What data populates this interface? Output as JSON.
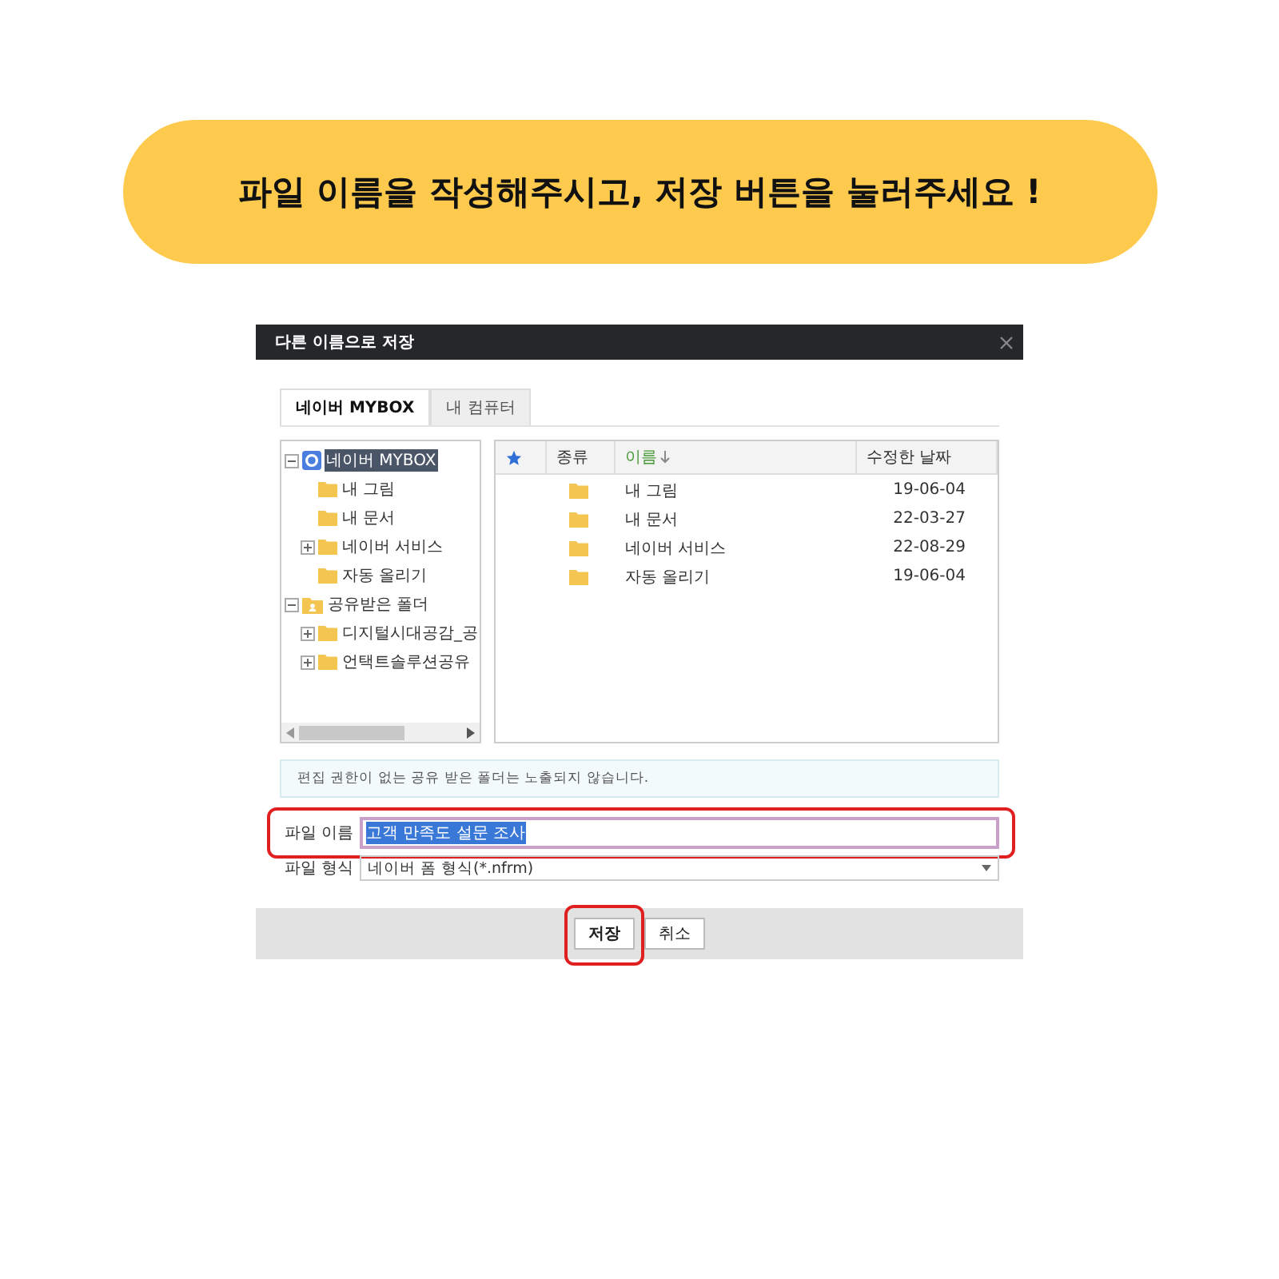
{
  "banner": {
    "text": "파일 이름을 작성해주시고, 저장 버튼을 눌러주세요 !"
  },
  "dialog": {
    "title": "다른 이름으로 저장",
    "tabs": [
      {
        "label": "네이버 MYBOX",
        "selected": true
      },
      {
        "label": "내 컴퓨터",
        "selected": false
      }
    ],
    "tree": [
      {
        "label": "네이버 MYBOX",
        "kind": "cloud",
        "expanded": true,
        "selected": true,
        "children": [
          {
            "label": "내 그림",
            "kind": "folder",
            "selected": false
          },
          {
            "label": "내 문서",
            "kind": "folder",
            "selected": false
          },
          {
            "label": "네이버 서비스",
            "kind": "folder",
            "expanded": false,
            "selected": false
          },
          {
            "label": "자동 올리기",
            "kind": "folder",
            "selected": false
          }
        ]
      },
      {
        "label": "공유받은 폴더",
        "kind": "shared",
        "expanded": true,
        "selected": false,
        "children": [
          {
            "label": "디지털시대공감_공",
            "kind": "folder",
            "expanded": false,
            "selected": false
          },
          {
            "label": "언택트솔루션공유",
            "kind": "folder",
            "expanded": false,
            "selected": false
          }
        ]
      }
    ],
    "columns": [
      {
        "kind": "star",
        "sorted": false
      },
      {
        "label": "종류",
        "kind": "text",
        "sorted": false
      },
      {
        "label": "이름",
        "kind": "text",
        "sorted": true
      },
      {
        "label": "수정한 날짜",
        "kind": "text",
        "sorted": false
      }
    ],
    "rows": [
      {
        "name": "내 그림",
        "date": "19-06-04"
      },
      {
        "name": "내 문서",
        "date": "22-03-27"
      },
      {
        "name": "네이버 서비스",
        "date": "22-08-29"
      },
      {
        "name": "자동 올리기",
        "date": "19-06-04"
      }
    ],
    "notice": "편집 권한이 없는 공유 받은 폴더는 노출되지 않습니다.",
    "filename": {
      "label": "파일 이름",
      "value": "고객 만족도 설문 조사",
      "highlighted": true
    },
    "filetype": {
      "label": "파일 형식",
      "value": "네이버 폼 형식(*.nfrm)"
    },
    "buttons": [
      {
        "label": "저장",
        "kind": "primary",
        "highlighted": true
      },
      {
        "label": "취소",
        "kind": "secondary",
        "highlighted": false
      }
    ]
  }
}
